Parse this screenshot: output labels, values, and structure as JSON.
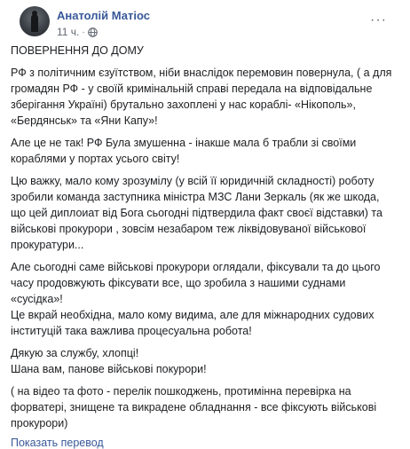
{
  "header": {
    "author": "Анатолій Матіос",
    "time": "11 ч.",
    "separator": "·",
    "privacy_icon": "globe-icon",
    "menu_label": "···"
  },
  "post": {
    "paragraphs": [
      "ПОВЕРНЕННЯ ДО ДОМУ",
      "РФ з політичним єзуїтством, ніби внаслідок перемовин повернула, ( а для громадян РФ - у своїй кримінальній справі передала на відповідальне зберігання Україні) брутально захоплені у нас кораблі- «Нікополь», «Бердянськ» та «Яни Капу»!",
      "Але це не так! РФ Була змушенна - інакше мала б трабли зі своїми кораблями у портах усього світу!",
      "Цю важку, мало кому зрозумілу (у всій її юридичній складності) роботу зробили команда заступника міністра МЗС Лани Зеркаль (як же шкода, що цей диплоиат від Бога сьогодні підтвердила факт своєї відставки) та військові прокурори , зовсім незабаром теж ліквідовуваної військової прокуратури...",
      "Але сьогодні саме військові прокурори оглядали, фіксували та до цього часу продовжують фіксувати все, що зробила з нашими суднами «сусідка»!",
      "Це вкрай необхідна, мало кому видима, але для міжнародних судових інституцій така важлива процесуальна робота!",
      "Дякую за службу, хлопці!",
      "Шана вам, панове військові покурори!",
      "( на відео та фото - перелік пошкоджень, протимінна перевірка на форватері, знищене та викрадене обладнання - все фіксують військові прокурори)"
    ],
    "translate_link": "Показать перевод"
  }
}
